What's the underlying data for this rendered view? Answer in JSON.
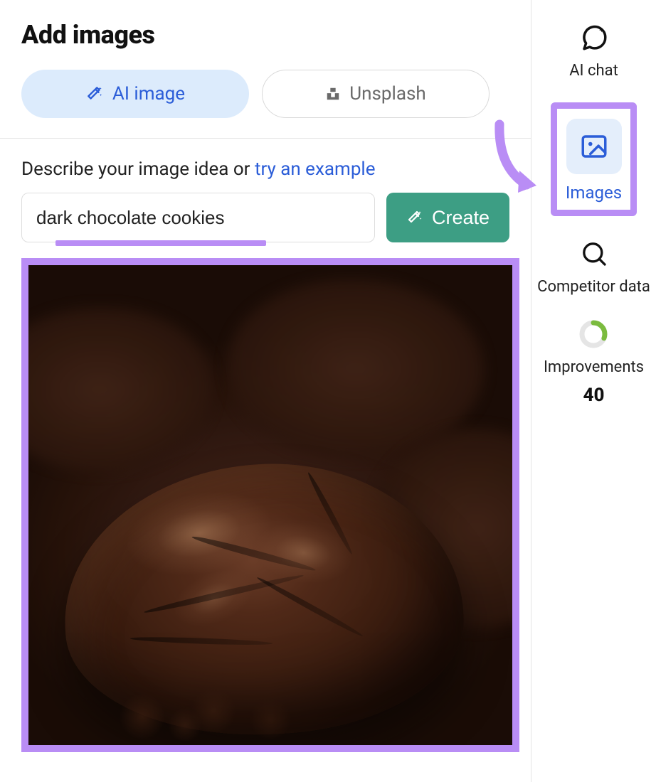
{
  "header": {
    "title": "Add images"
  },
  "tabs": {
    "ai_label": "AI image",
    "unsplash_label": "Unsplash"
  },
  "prompt": {
    "describe_text": "Describe your image idea or ",
    "example_link": "try an example",
    "input_value": "dark chocolate cookies",
    "create_label": "Create"
  },
  "sidebar": {
    "ai_chat": "AI chat",
    "images": "Images",
    "competitor": "Competitor data",
    "improvements_label": "Improvements",
    "improvements_count": "40"
  }
}
